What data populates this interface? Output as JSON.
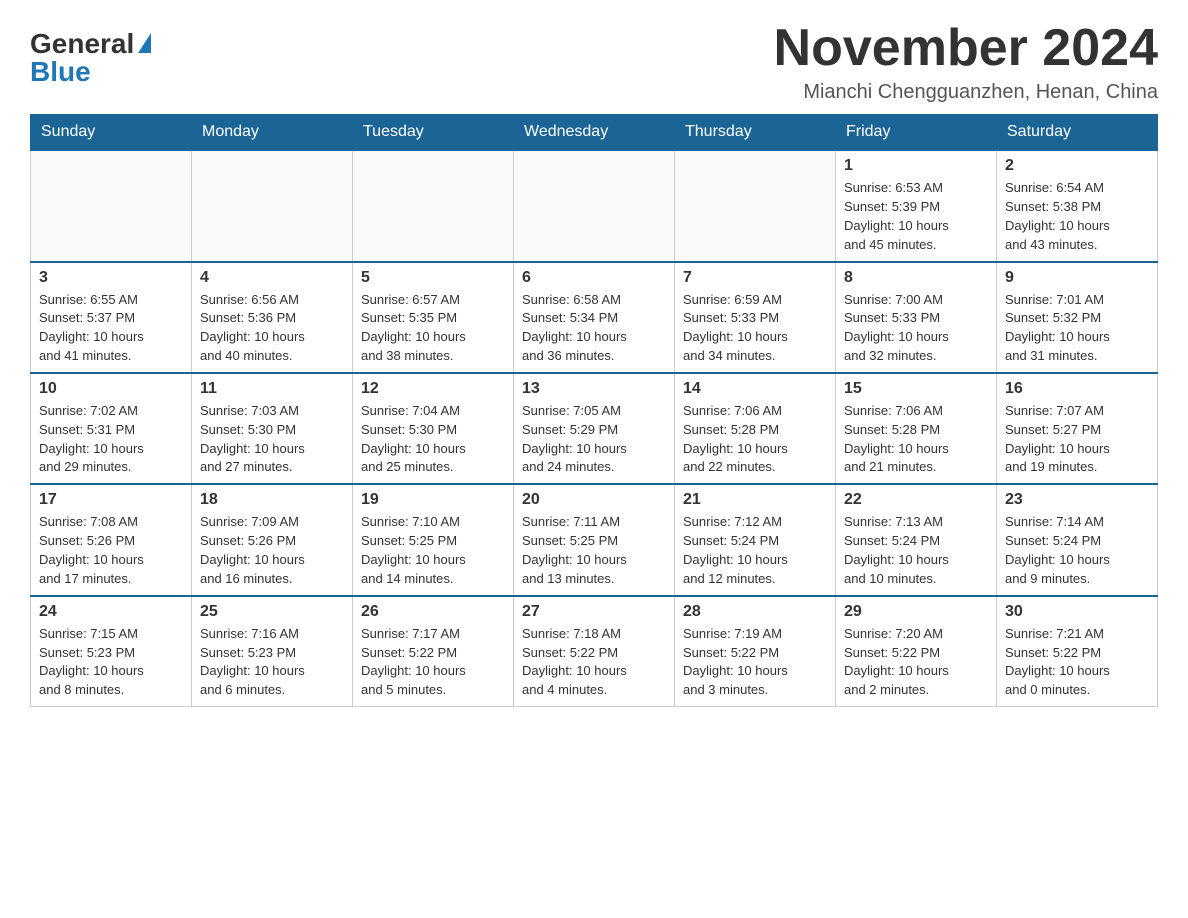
{
  "header": {
    "logo_general": "General",
    "logo_blue": "Blue",
    "month_title": "November 2024",
    "subtitle": "Mianchi Chengguanzhen, Henan, China"
  },
  "weekdays": [
    "Sunday",
    "Monday",
    "Tuesday",
    "Wednesday",
    "Thursday",
    "Friday",
    "Saturday"
  ],
  "weeks": [
    [
      {
        "day": "",
        "info": ""
      },
      {
        "day": "",
        "info": ""
      },
      {
        "day": "",
        "info": ""
      },
      {
        "day": "",
        "info": ""
      },
      {
        "day": "",
        "info": ""
      },
      {
        "day": "1",
        "info": "Sunrise: 6:53 AM\nSunset: 5:39 PM\nDaylight: 10 hours\nand 45 minutes."
      },
      {
        "day": "2",
        "info": "Sunrise: 6:54 AM\nSunset: 5:38 PM\nDaylight: 10 hours\nand 43 minutes."
      }
    ],
    [
      {
        "day": "3",
        "info": "Sunrise: 6:55 AM\nSunset: 5:37 PM\nDaylight: 10 hours\nand 41 minutes."
      },
      {
        "day": "4",
        "info": "Sunrise: 6:56 AM\nSunset: 5:36 PM\nDaylight: 10 hours\nand 40 minutes."
      },
      {
        "day": "5",
        "info": "Sunrise: 6:57 AM\nSunset: 5:35 PM\nDaylight: 10 hours\nand 38 minutes."
      },
      {
        "day": "6",
        "info": "Sunrise: 6:58 AM\nSunset: 5:34 PM\nDaylight: 10 hours\nand 36 minutes."
      },
      {
        "day": "7",
        "info": "Sunrise: 6:59 AM\nSunset: 5:33 PM\nDaylight: 10 hours\nand 34 minutes."
      },
      {
        "day": "8",
        "info": "Sunrise: 7:00 AM\nSunset: 5:33 PM\nDaylight: 10 hours\nand 32 minutes."
      },
      {
        "day": "9",
        "info": "Sunrise: 7:01 AM\nSunset: 5:32 PM\nDaylight: 10 hours\nand 31 minutes."
      }
    ],
    [
      {
        "day": "10",
        "info": "Sunrise: 7:02 AM\nSunset: 5:31 PM\nDaylight: 10 hours\nand 29 minutes."
      },
      {
        "day": "11",
        "info": "Sunrise: 7:03 AM\nSunset: 5:30 PM\nDaylight: 10 hours\nand 27 minutes."
      },
      {
        "day": "12",
        "info": "Sunrise: 7:04 AM\nSunset: 5:30 PM\nDaylight: 10 hours\nand 25 minutes."
      },
      {
        "day": "13",
        "info": "Sunrise: 7:05 AM\nSunset: 5:29 PM\nDaylight: 10 hours\nand 24 minutes."
      },
      {
        "day": "14",
        "info": "Sunrise: 7:06 AM\nSunset: 5:28 PM\nDaylight: 10 hours\nand 22 minutes."
      },
      {
        "day": "15",
        "info": "Sunrise: 7:06 AM\nSunset: 5:28 PM\nDaylight: 10 hours\nand 21 minutes."
      },
      {
        "day": "16",
        "info": "Sunrise: 7:07 AM\nSunset: 5:27 PM\nDaylight: 10 hours\nand 19 minutes."
      }
    ],
    [
      {
        "day": "17",
        "info": "Sunrise: 7:08 AM\nSunset: 5:26 PM\nDaylight: 10 hours\nand 17 minutes."
      },
      {
        "day": "18",
        "info": "Sunrise: 7:09 AM\nSunset: 5:26 PM\nDaylight: 10 hours\nand 16 minutes."
      },
      {
        "day": "19",
        "info": "Sunrise: 7:10 AM\nSunset: 5:25 PM\nDaylight: 10 hours\nand 14 minutes."
      },
      {
        "day": "20",
        "info": "Sunrise: 7:11 AM\nSunset: 5:25 PM\nDaylight: 10 hours\nand 13 minutes."
      },
      {
        "day": "21",
        "info": "Sunrise: 7:12 AM\nSunset: 5:24 PM\nDaylight: 10 hours\nand 12 minutes."
      },
      {
        "day": "22",
        "info": "Sunrise: 7:13 AM\nSunset: 5:24 PM\nDaylight: 10 hours\nand 10 minutes."
      },
      {
        "day": "23",
        "info": "Sunrise: 7:14 AM\nSunset: 5:24 PM\nDaylight: 10 hours\nand 9 minutes."
      }
    ],
    [
      {
        "day": "24",
        "info": "Sunrise: 7:15 AM\nSunset: 5:23 PM\nDaylight: 10 hours\nand 8 minutes."
      },
      {
        "day": "25",
        "info": "Sunrise: 7:16 AM\nSunset: 5:23 PM\nDaylight: 10 hours\nand 6 minutes."
      },
      {
        "day": "26",
        "info": "Sunrise: 7:17 AM\nSunset: 5:22 PM\nDaylight: 10 hours\nand 5 minutes."
      },
      {
        "day": "27",
        "info": "Sunrise: 7:18 AM\nSunset: 5:22 PM\nDaylight: 10 hours\nand 4 minutes."
      },
      {
        "day": "28",
        "info": "Sunrise: 7:19 AM\nSunset: 5:22 PM\nDaylight: 10 hours\nand 3 minutes."
      },
      {
        "day": "29",
        "info": "Sunrise: 7:20 AM\nSunset: 5:22 PM\nDaylight: 10 hours\nand 2 minutes."
      },
      {
        "day": "30",
        "info": "Sunrise: 7:21 AM\nSunset: 5:22 PM\nDaylight: 10 hours\nand 0 minutes."
      }
    ]
  ]
}
